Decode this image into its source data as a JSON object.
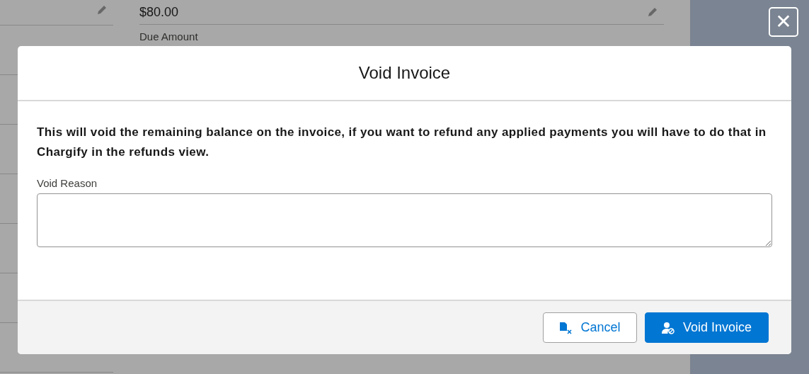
{
  "background": {
    "fields": [
      {
        "value": "$80.00",
        "label": "Due Amount"
      }
    ]
  },
  "close_button": {
    "label": "✕"
  },
  "modal": {
    "title": "Void Invoice",
    "message": "This will void the remaining balance on the invoice, if you want to refund any applied payments you will have to do that in Chargify in the refunds view.",
    "field": {
      "label": "Void Reason"
    },
    "buttons": [
      {
        "label": "Cancel",
        "kind": "neutral"
      },
      {
        "label": "Void Invoice",
        "kind": "brand"
      }
    ]
  }
}
